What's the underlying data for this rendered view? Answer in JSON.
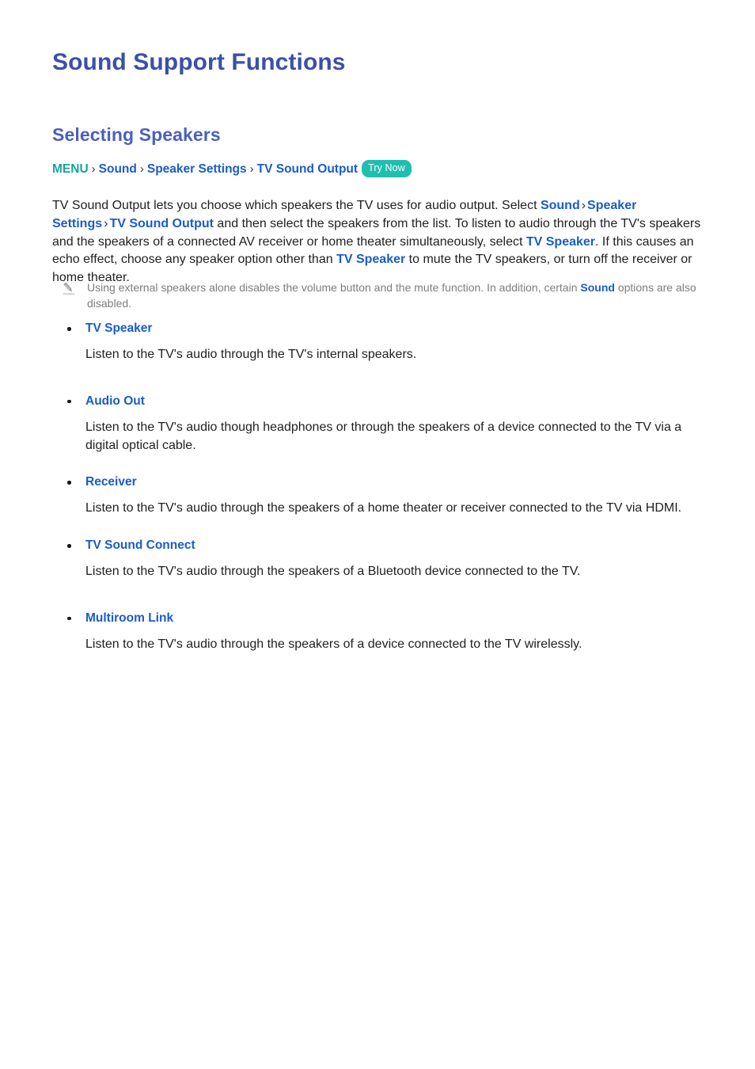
{
  "document": {
    "title": "Sound Support Functions",
    "section_heading": "Selecting Speakers"
  },
  "breadcrumb": {
    "menu_label": "MENU",
    "separator": "›",
    "items": [
      "Sound",
      "Speaker Settings",
      "TV Sound Output"
    ],
    "badge_label": "Try Now"
  },
  "intro": {
    "part1": "TV Sound Output lets you choose which speakers the TV uses for audio output. Select ",
    "link1": "Sound",
    "sep1": "›",
    "link2": "Speaker Settings",
    "sep2": "›",
    "link3": "TV Sound Output",
    "part2": " and then select the speakers from the list. To listen to audio through the TV's speakers and the speakers of a connected AV receiver or home theater simultaneously, select ",
    "link4": "TV Speaker",
    "part3": ". If this causes an echo effect, choose any speaker option other than ",
    "link5": "TV Speaker",
    "part4": " to mute the TV speakers, or turn off the receiver or home theater."
  },
  "note": {
    "icon": "pencil-icon",
    "text_before": "Using external speakers alone disables the volume button and the mute function. In addition, certain ",
    "link": "Sound",
    "text_after": " options are also disabled."
  },
  "speakers": [
    {
      "label": "TV Speaker",
      "description": "Listen to the TV's audio through the TV's internal speakers."
    },
    {
      "label": "Audio Out",
      "description": "Listen to the TV's audio though headphones or through the speakers of a device connected to the TV via a digital optical cable."
    },
    {
      "label": "Receiver",
      "description": "Listen to the TV's audio through the speakers of a home theater or receiver connected to the TV via HDMI."
    },
    {
      "label": "TV Sound Connect",
      "description": "Listen to the TV's audio through the speakers of a Bluetooth device connected to the TV."
    },
    {
      "label": "Multiroom Link",
      "description": "Listen to the TV's audio through the speakers of a device connected to the TV wirelessly."
    }
  ],
  "colors": {
    "title_blue": "#3a50a8",
    "section_blue": "#4c5fbe",
    "link_blue": "#1a5cc8",
    "menu_teal": "#17a3a0",
    "badge_teal": "#1fbfb0",
    "note_gray": "#7d7d7d",
    "body_text": "#1f1f1f"
  }
}
